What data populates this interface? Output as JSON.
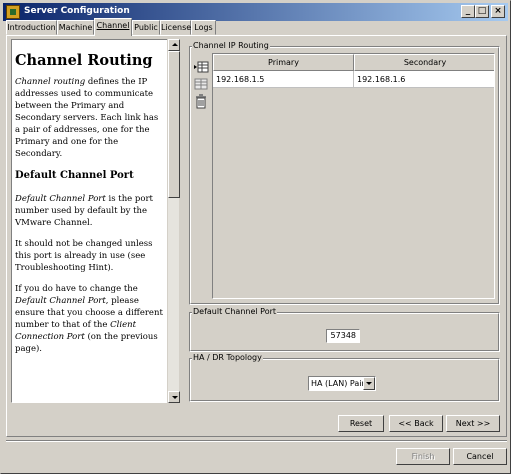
{
  "window": {
    "title": "Server Configuration",
    "minimize_glyph": "_",
    "maximize_glyph": "□",
    "close_glyph": "×"
  },
  "tabs": [
    {
      "label": "Introduction"
    },
    {
      "label": "Machine"
    },
    {
      "label": "Channel"
    },
    {
      "label": "Public"
    },
    {
      "label": "License"
    },
    {
      "label": "Logs"
    }
  ],
  "active_tab": "Channel",
  "help": {
    "heading1": "Channel Routing",
    "p1_em": "Channel routing",
    "p1_rest": " defines the IP addresses used to communicate between the Primary and Secondary servers. Each link has a pair of addresses, one for the Primary and one for the Secondary.",
    "heading2": "Default Channel Port",
    "p2_em": "Default Channel Port",
    "p2_rest": " is the port number used by default by the VMware Channel.",
    "p3": "It should not be changed unless this port is already in use (see Troubleshooting Hint).",
    "p4_a": "If you do have to change the ",
    "p4_em1": "Default Channel Port",
    "p4_b": ", please ensure that you choose a different number to that of the ",
    "p4_em2": "Client Connection Port",
    "p4_c": " (on the previous page)."
  },
  "routing": {
    "group_label": "Channel IP Routing",
    "columns": [
      "Primary",
      "Secondary"
    ],
    "rows": [
      {
        "primary": "192.168.1.5",
        "secondary": "192.168.1.6"
      }
    ],
    "tool_icons": [
      "add-route-icon",
      "edit-route-icon",
      "delete-route-icon"
    ]
  },
  "port": {
    "group_label": "Default Channel Port",
    "value": "57348"
  },
  "topology": {
    "group_label": "HA / DR Topology",
    "selected": "HA (LAN) Pair"
  },
  "nav": {
    "reset": "Reset",
    "back": "<< Back",
    "next": "Next >>"
  },
  "footer": {
    "finish": "Finish",
    "cancel": "Cancel"
  }
}
